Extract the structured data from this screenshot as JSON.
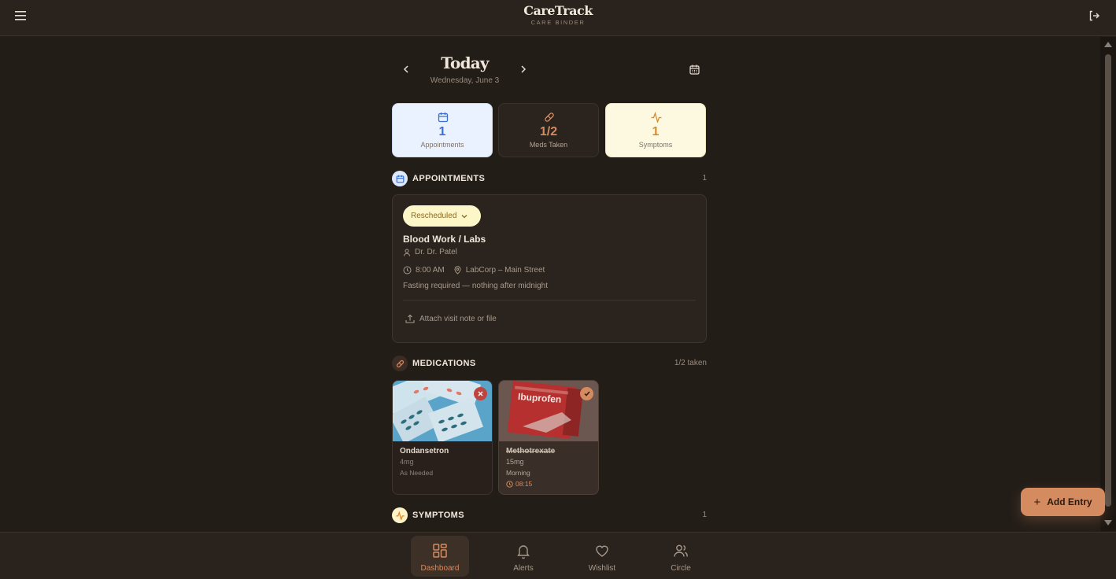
{
  "header": {
    "brand_title": "CareTrack",
    "brand_subtitle": "CARE BINDER",
    "menu_icon": "menu-icon",
    "logout_icon": "logout-icon"
  },
  "date_nav": {
    "title": "Today",
    "subtitle": "Wednesday, June 3"
  },
  "stats": [
    {
      "value": "1",
      "label": "Appointments",
      "icon": "calendar-icon",
      "color": "#3a6fd1"
    },
    {
      "value": "1/2",
      "label": "Meds Taken",
      "icon": "pill-icon",
      "color": "#d58b60"
    },
    {
      "value": "1",
      "label": "Symptoms",
      "icon": "activity-icon",
      "color": "#d98a2f"
    }
  ],
  "appointments": {
    "heading": "APPOINTMENTS",
    "count": "1",
    "items": [
      {
        "status": "Rescheduled",
        "title": "Blood Work / Labs",
        "doctor": "Dr. Dr. Patel",
        "time": "8:00 AM",
        "location": "LabCorp – Main Street",
        "note": "Fasting required — nothing after midnight",
        "attach_label": "Attach visit note or file"
      }
    ]
  },
  "medications": {
    "heading": "MEDICATIONS",
    "count": "1/2 taken",
    "items": [
      {
        "name": "Ondansetron",
        "dose": "4mg",
        "frequency": "As Needed",
        "taken": false,
        "status_icon": "close-icon"
      },
      {
        "name": "Methotrexate",
        "dose": "15mg",
        "frequency": "Morning",
        "time": "08:15",
        "taken": true,
        "status_icon": "check-icon",
        "package_text": "Ibuprofen"
      }
    ]
  },
  "symptoms": {
    "heading": "SYMPTOMS",
    "count": "1"
  },
  "fab": {
    "label": "Add Entry"
  },
  "bottom_nav": [
    {
      "label": "Dashboard",
      "icon": "dashboard-icon",
      "active": true
    },
    {
      "label": "Alerts",
      "icon": "bell-icon",
      "active": false
    },
    {
      "label": "Wishlist",
      "icon": "heart-icon",
      "active": false
    },
    {
      "label": "Circle",
      "icon": "users-icon",
      "active": false
    }
  ],
  "colors": {
    "background": "#231d18",
    "accent": "#d58b60",
    "appointment_blue": "#3a6fd1",
    "symptom_amber": "#d98a2f",
    "rescheduled_pill": "#fdf6c8",
    "missed_red": "#c0443e"
  }
}
